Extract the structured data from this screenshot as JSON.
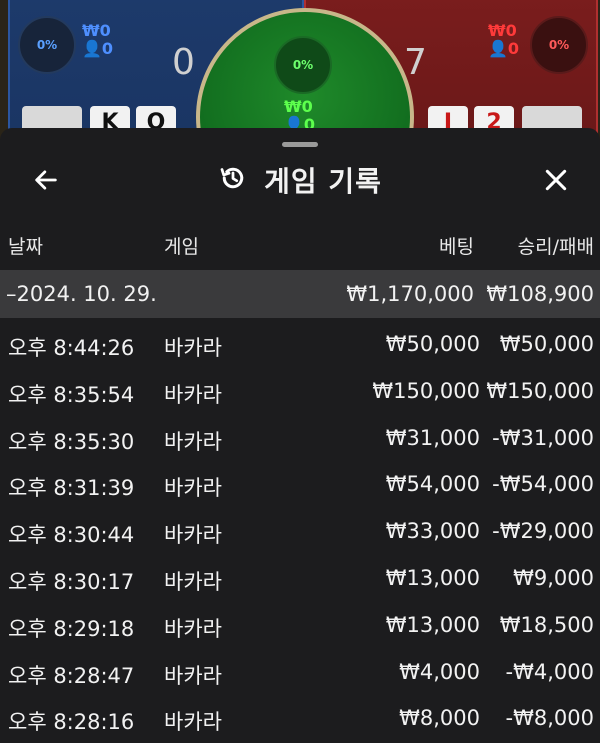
{
  "game": {
    "player": {
      "percent": "0%",
      "amount": "₩0",
      "bettors": "0",
      "score": "0",
      "cards": [
        "K",
        "Q"
      ]
    },
    "tie": {
      "percent": "0%",
      "amount": "₩0",
      "bettors": "0"
    },
    "banker": {
      "percent": "0%",
      "amount": "₩0",
      "bettors": "0",
      "score": "7",
      "cards": [
        "J",
        "2"
      ]
    },
    "colors": {
      "player": "#2b56a0",
      "banker": "#b03030",
      "tie": "#137020"
    }
  },
  "history": {
    "title": "게임 기록",
    "icons": {
      "back": "arrow-left-icon",
      "history": "history-clock-icon",
      "close": "close-icon"
    },
    "columns": {
      "date": "날짜",
      "game": "게임",
      "bet": "베팅",
      "win_loss": "승리/패배"
    },
    "date_group": {
      "label": "–2024. 10. 29.",
      "total_bet": "₩1,170,000",
      "total_wl": "₩108,900"
    },
    "rows": [
      {
        "time": "오후 8:44:26",
        "game": "바카라",
        "bet": "₩50,000",
        "wl": "₩50,000"
      },
      {
        "time": "오후 8:35:54",
        "game": "바카라",
        "bet": "₩150,000",
        "wl": "₩150,000"
      },
      {
        "time": "오후 8:35:30",
        "game": "바카라",
        "bet": "₩31,000",
        "wl": "-₩31,000"
      },
      {
        "time": "오후 8:31:39",
        "game": "바카라",
        "bet": "₩54,000",
        "wl": "-₩54,000"
      },
      {
        "time": "오후 8:30:44",
        "game": "바카라",
        "bet": "₩33,000",
        "wl": "-₩29,000"
      },
      {
        "time": "오후 8:30:17",
        "game": "바카라",
        "bet": "₩13,000",
        "wl": "₩9,000"
      },
      {
        "time": "오후 8:29:18",
        "game": "바카라",
        "bet": "₩13,000",
        "wl": "₩18,500"
      },
      {
        "time": "오후 8:28:47",
        "game": "바카라",
        "bet": "₩4,000",
        "wl": "-₩4,000"
      },
      {
        "time": "오후 8:28:16",
        "game": "바카라",
        "bet": "₩8,000",
        "wl": "-₩8,000"
      }
    ]
  }
}
